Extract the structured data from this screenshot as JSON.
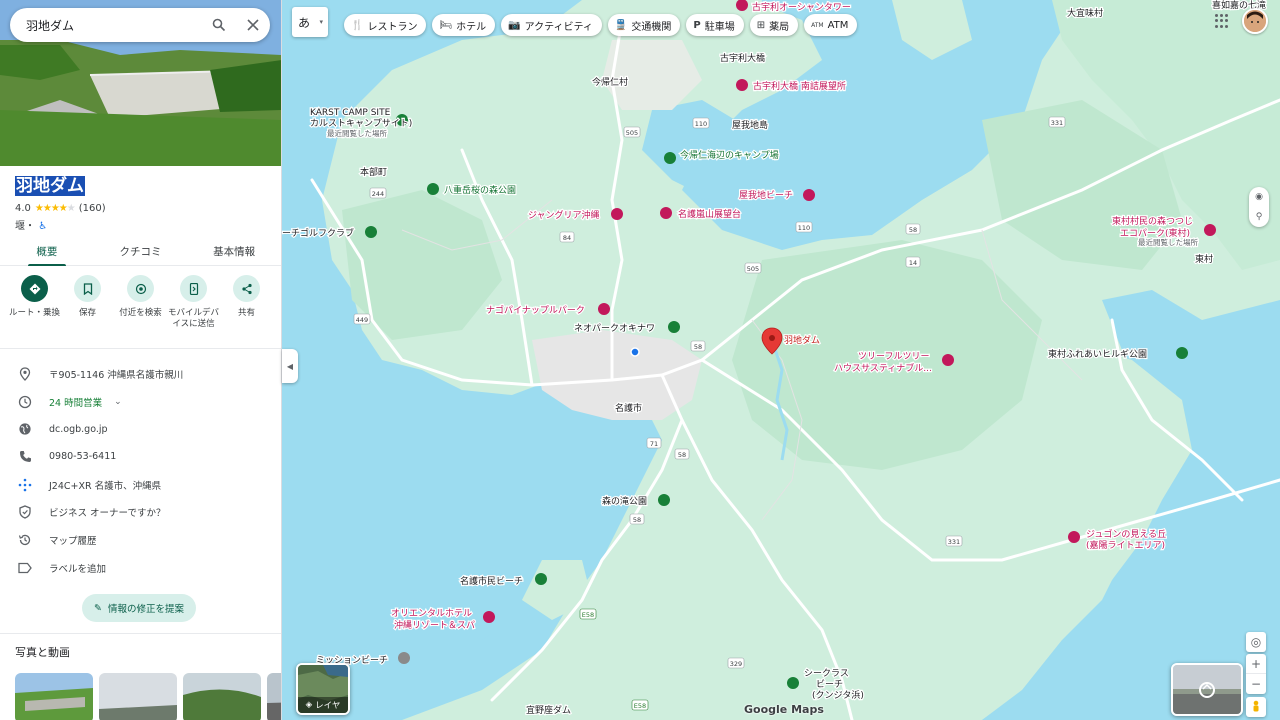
{
  "search": {
    "query": "羽地ダム"
  },
  "place": {
    "name": "羽地ダム",
    "rating": "4.0",
    "reviews": "(160)",
    "category": "堰・",
    "accessibility_icon": "wheelchair-icon"
  },
  "tabs": [
    {
      "label": "概要"
    },
    {
      "label": "クチコミ"
    },
    {
      "label": "基本情報"
    }
  ],
  "actions": [
    {
      "label": "ルート・乗換",
      "icon": "directions-icon"
    },
    {
      "label": "保存",
      "icon": "bookmark-icon"
    },
    {
      "label": "付近を検索",
      "icon": "nearby-icon"
    },
    {
      "label": "モバイルデバイスに送信",
      "icon": "send-to-phone-icon"
    },
    {
      "label": "共有",
      "icon": "share-icon"
    }
  ],
  "info": {
    "address": "〒905-1146 沖縄県名護市親川",
    "hours": "24 時間営業",
    "website": "dc.ogb.go.jp",
    "phone": "0980-53-6411",
    "pluscode": "J24C+XR 名護市、沖縄県",
    "owner": "ビジネス オーナーですか？",
    "history": "マップ履歴",
    "label": "ラベルを追加"
  },
  "suggest_edit": "情報の修正を提案",
  "photos_title": "写真と動画",
  "map": {
    "ime_label": "あ",
    "chips": [
      {
        "label": "レストラン",
        "icon": "restaurant-icon"
      },
      {
        "label": "ホテル",
        "icon": "hotel-icon"
      },
      {
        "label": "アクティビティ",
        "icon": "camera-icon"
      },
      {
        "label": "交通機関",
        "icon": "transit-icon"
      },
      {
        "label": "駐車場",
        "icon": "parking-icon"
      },
      {
        "label": "薬局",
        "icon": "pharmacy-icon"
      },
      {
        "label": "ATM",
        "icon": "atm-icon"
      }
    ],
    "layers_label": "レイヤ",
    "logo": "Google Maps",
    "labels": {
      "l1": "古宇利オーシャンタワー",
      "l2": "古宇利大橋",
      "l3": "古宇利大橋 南詰展望所",
      "l4": "今帰仁村",
      "l5": "屋我地島",
      "l6": "KARST CAMP SITE",
      "l7": "カルストキャンプサイト)",
      "l8": "最近閲覧した場所",
      "l9": "今帰仁海辺のキャンプ場",
      "l10": "本部町",
      "l11": "八重岳桜の森公園",
      "l12": "屋我地ビーチ",
      "l13": "ジャングリア沖縄",
      "l14": "名護嵐山展望台",
      "l15": "ーチゴルフクラブ",
      "l16": "ナゴパイナップルパーク",
      "l17": "ネオパークオキナワ",
      "l18": "羽地ダム",
      "l19": "ツリーフルツリー",
      "l20": "ハウスサスティナブル...",
      "l21": "名護市",
      "l22": "東村ふれあいヒルギ公園",
      "l23": "東村村民の森つつじ",
      "l24": "エコパーク(東村)",
      "l25": "最近閲覧した場所",
      "l26": "東村",
      "l27": "大宜味村",
      "l28": "喜如嘉の七滝",
      "l29": "森の滝公園",
      "l30": "ジュゴンの見える丘",
      "l31": "(嘉陽ライトエリア)",
      "l32": "名護市民ビーチ",
      "l33": "オリエンタルホテル",
      "l34": "沖縄リゾート＆スパ",
      "l35": "ミッションビーチ",
      "l36": "シークラス",
      "l37": "ビーチ",
      "l38": "(クンジタ浜)",
      "l39": "宜野座ダム"
    },
    "roads": [
      "505",
      "110",
      "244",
      "84",
      "449",
      "58",
      "110",
      "505",
      "58",
      "14",
      "331",
      "331",
      "71",
      "58",
      "329",
      "58",
      "E58",
      "E58"
    ],
    "colors": {
      "water": "#9cdcf0",
      "land": "#cfeedd",
      "forest": "#bde8cf",
      "urban": "#ececec",
      "road": "#ffffff",
      "accent": "#0b5f4a",
      "pin": "#e53935"
    }
  }
}
